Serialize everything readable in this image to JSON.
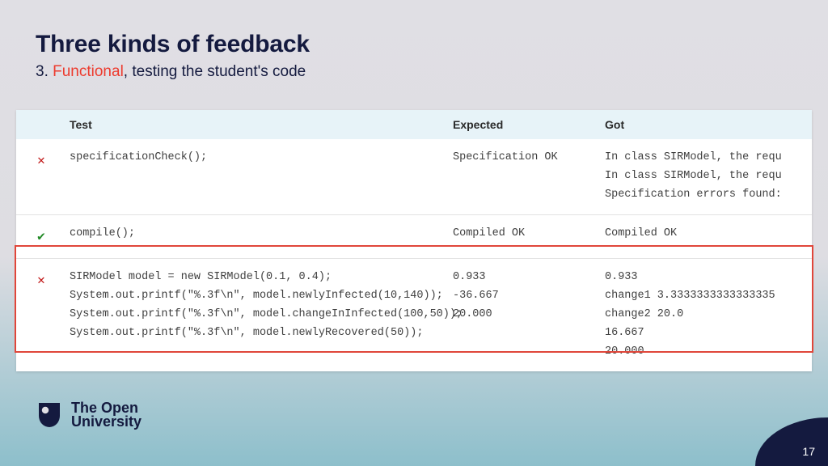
{
  "title": "Three kinds of feedback",
  "subtitle_prefix": "3. ",
  "subtitle_accent": "Functional",
  "subtitle_rest": ", testing the student's code",
  "headers": {
    "test": "Test",
    "expected": "Expected",
    "got": "Got"
  },
  "rows": [
    {
      "status": "fail",
      "test": [
        "specificationCheck();"
      ],
      "expected": [
        "Specification OK"
      ],
      "got": [
        "In class SIRModel, the requ",
        "In class SIRModel, the requ",
        "Specification errors found:"
      ]
    },
    {
      "status": "pass",
      "test": [
        "compile();"
      ],
      "expected": [
        "Compiled OK"
      ],
      "got": [
        "Compiled OK"
      ]
    },
    {
      "status": "fail",
      "test": [
        "SIRModel model = new SIRModel(0.1, 0.4);",
        "System.out.printf(\"%.3f\\n\", model.newlyInfected(10,140));",
        "System.out.printf(\"%.3f\\n\", model.changeInInfected(100,50));",
        "System.out.printf(\"%.3f\\n\", model.newlyRecovered(50));"
      ],
      "expected": [
        "0.933",
        "-36.667",
        "20.000"
      ],
      "got": [
        "0.933",
        "change1 3.3333333333333335",
        "change2 20.0",
        "16.667",
        "20.000"
      ]
    }
  ],
  "logo": {
    "line1": "The Open",
    "line2": "University"
  },
  "page_number": "17",
  "icons": {
    "cross": "✕",
    "check": "✔"
  }
}
